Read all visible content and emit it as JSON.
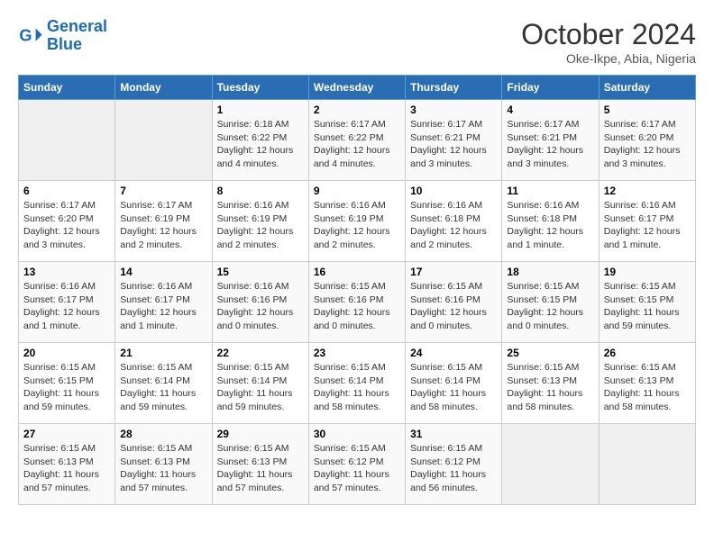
{
  "logo": {
    "line1": "General",
    "line2": "Blue"
  },
  "title": "October 2024",
  "subtitle": "Oke-Ikpe, Abia, Nigeria",
  "days_of_week": [
    "Sunday",
    "Monday",
    "Tuesday",
    "Wednesday",
    "Thursday",
    "Friday",
    "Saturday"
  ],
  "weeks": [
    [
      {
        "day": "",
        "info": ""
      },
      {
        "day": "",
        "info": ""
      },
      {
        "day": "1",
        "info": "Sunrise: 6:18 AM\nSunset: 6:22 PM\nDaylight: 12 hours and 4 minutes."
      },
      {
        "day": "2",
        "info": "Sunrise: 6:17 AM\nSunset: 6:22 PM\nDaylight: 12 hours and 4 minutes."
      },
      {
        "day": "3",
        "info": "Sunrise: 6:17 AM\nSunset: 6:21 PM\nDaylight: 12 hours and 3 minutes."
      },
      {
        "day": "4",
        "info": "Sunrise: 6:17 AM\nSunset: 6:21 PM\nDaylight: 12 hours and 3 minutes."
      },
      {
        "day": "5",
        "info": "Sunrise: 6:17 AM\nSunset: 6:20 PM\nDaylight: 12 hours and 3 minutes."
      }
    ],
    [
      {
        "day": "6",
        "info": "Sunrise: 6:17 AM\nSunset: 6:20 PM\nDaylight: 12 hours and 3 minutes."
      },
      {
        "day": "7",
        "info": "Sunrise: 6:17 AM\nSunset: 6:19 PM\nDaylight: 12 hours and 2 minutes."
      },
      {
        "day": "8",
        "info": "Sunrise: 6:16 AM\nSunset: 6:19 PM\nDaylight: 12 hours and 2 minutes."
      },
      {
        "day": "9",
        "info": "Sunrise: 6:16 AM\nSunset: 6:19 PM\nDaylight: 12 hours and 2 minutes."
      },
      {
        "day": "10",
        "info": "Sunrise: 6:16 AM\nSunset: 6:18 PM\nDaylight: 12 hours and 2 minutes."
      },
      {
        "day": "11",
        "info": "Sunrise: 6:16 AM\nSunset: 6:18 PM\nDaylight: 12 hours and 1 minute."
      },
      {
        "day": "12",
        "info": "Sunrise: 6:16 AM\nSunset: 6:17 PM\nDaylight: 12 hours and 1 minute."
      }
    ],
    [
      {
        "day": "13",
        "info": "Sunrise: 6:16 AM\nSunset: 6:17 PM\nDaylight: 12 hours and 1 minute."
      },
      {
        "day": "14",
        "info": "Sunrise: 6:16 AM\nSunset: 6:17 PM\nDaylight: 12 hours and 1 minute."
      },
      {
        "day": "15",
        "info": "Sunrise: 6:16 AM\nSunset: 6:16 PM\nDaylight: 12 hours and 0 minutes."
      },
      {
        "day": "16",
        "info": "Sunrise: 6:15 AM\nSunset: 6:16 PM\nDaylight: 12 hours and 0 minutes."
      },
      {
        "day": "17",
        "info": "Sunrise: 6:15 AM\nSunset: 6:16 PM\nDaylight: 12 hours and 0 minutes."
      },
      {
        "day": "18",
        "info": "Sunrise: 6:15 AM\nSunset: 6:15 PM\nDaylight: 12 hours and 0 minutes."
      },
      {
        "day": "19",
        "info": "Sunrise: 6:15 AM\nSunset: 6:15 PM\nDaylight: 11 hours and 59 minutes."
      }
    ],
    [
      {
        "day": "20",
        "info": "Sunrise: 6:15 AM\nSunset: 6:15 PM\nDaylight: 11 hours and 59 minutes."
      },
      {
        "day": "21",
        "info": "Sunrise: 6:15 AM\nSunset: 6:14 PM\nDaylight: 11 hours and 59 minutes."
      },
      {
        "day": "22",
        "info": "Sunrise: 6:15 AM\nSunset: 6:14 PM\nDaylight: 11 hours and 59 minutes."
      },
      {
        "day": "23",
        "info": "Sunrise: 6:15 AM\nSunset: 6:14 PM\nDaylight: 11 hours and 58 minutes."
      },
      {
        "day": "24",
        "info": "Sunrise: 6:15 AM\nSunset: 6:14 PM\nDaylight: 11 hours and 58 minutes."
      },
      {
        "day": "25",
        "info": "Sunrise: 6:15 AM\nSunset: 6:13 PM\nDaylight: 11 hours and 58 minutes."
      },
      {
        "day": "26",
        "info": "Sunrise: 6:15 AM\nSunset: 6:13 PM\nDaylight: 11 hours and 58 minutes."
      }
    ],
    [
      {
        "day": "27",
        "info": "Sunrise: 6:15 AM\nSunset: 6:13 PM\nDaylight: 11 hours and 57 minutes."
      },
      {
        "day": "28",
        "info": "Sunrise: 6:15 AM\nSunset: 6:13 PM\nDaylight: 11 hours and 57 minutes."
      },
      {
        "day": "29",
        "info": "Sunrise: 6:15 AM\nSunset: 6:13 PM\nDaylight: 11 hours and 57 minutes."
      },
      {
        "day": "30",
        "info": "Sunrise: 6:15 AM\nSunset: 6:12 PM\nDaylight: 11 hours and 57 minutes."
      },
      {
        "day": "31",
        "info": "Sunrise: 6:15 AM\nSunset: 6:12 PM\nDaylight: 11 hours and 56 minutes."
      },
      {
        "day": "",
        "info": ""
      },
      {
        "day": "",
        "info": ""
      }
    ]
  ]
}
